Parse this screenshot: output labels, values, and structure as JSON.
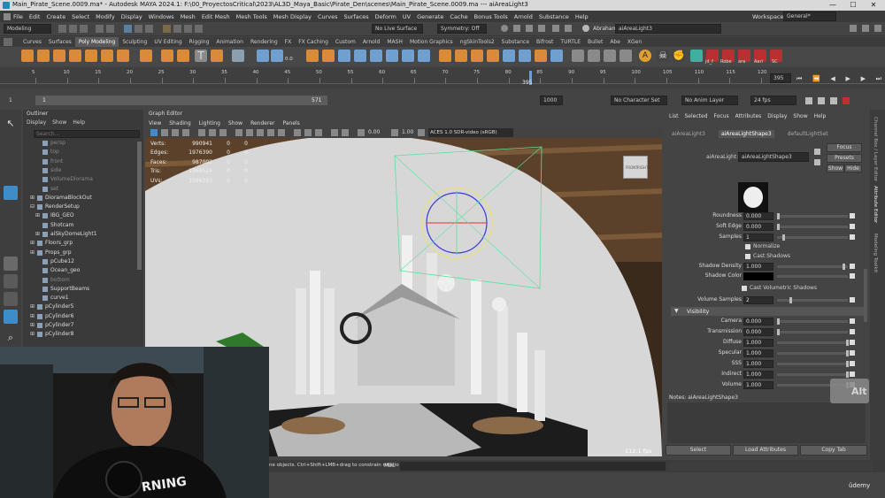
{
  "window": {
    "title": "Main_Pirate_Scene.0009.ma* - Autodesk MAYA 2024.1: F:\\00_ProyectosCritical\\2023\\AL3D_Maya_Basic\\Pirate_Den\\scenes\\Main_Pirate_Scene.0009.ma  ---  aiAreaLight3",
    "minimize": "—",
    "maximize": "☐",
    "close": "✕"
  },
  "menubar": {
    "items": [
      "File",
      "Edit",
      "Create",
      "Select",
      "Modify",
      "Display",
      "Windows",
      "Mesh",
      "Edit Mesh",
      "Mesh Tools",
      "Mesh Display",
      "Curves",
      "Surfaces",
      "Deform",
      "UV",
      "Generate",
      "Cache",
      "Bonus Tools",
      "Arnold",
      "Substance",
      "Help"
    ],
    "workspace_label": "Workspace:",
    "workspace_value": "General*"
  },
  "statusline": {
    "mode": "Modeling",
    "live_surface": "No Live Surface",
    "symmetry": "Symmetry: Off",
    "user": "Abraham Leal",
    "search_value": "aiAreaLight3"
  },
  "shelf": {
    "tabs": [
      "Curves",
      "Surfaces",
      "Poly Modeling",
      "Sculpting",
      "UV Editing",
      "Rigging",
      "Animation",
      "Rendering",
      "FX",
      "FX Caching",
      "Custom",
      "Arnold",
      "MASH",
      "Motion Graphics",
      "ngSkinTools2",
      "Substance",
      "Bifrost",
      "TURTLE",
      "Bullet",
      "Abe",
      "XGen"
    ],
    "active_tab": "Poly Modeling",
    "counters": [
      "0.0",
      "0.0"
    ],
    "right_labels": [
      "jd_f",
      "Robe",
      "ara",
      "Aari",
      "SC"
    ]
  },
  "timeline": {
    "ticks": [
      "5",
      "10",
      "15",
      "20",
      "25",
      "30",
      "35",
      "40",
      "45",
      "50",
      "55",
      "60",
      "65",
      "70",
      "75",
      "80",
      "85",
      "90",
      "95",
      "100",
      "105",
      "110",
      "115",
      "120"
    ],
    "current_frame": "395"
  },
  "range": {
    "start": "1",
    "start2": "1",
    "end_inner": "571",
    "end": "1000",
    "character_set": "No Character Set",
    "anim_layer": "No Anim Layer",
    "fps": "24 fps"
  },
  "outliner": {
    "title": "Outliner",
    "menu": [
      "Display",
      "Show",
      "Help"
    ],
    "search_placeholder": "Search...",
    "items": [
      {
        "label": "persp",
        "depth": 1,
        "exp": ""
      },
      {
        "label": "top",
        "depth": 1,
        "exp": ""
      },
      {
        "label": "front",
        "depth": 1,
        "exp": ""
      },
      {
        "label": "side",
        "depth": 1,
        "exp": ""
      },
      {
        "label": "VolumeDiorama",
        "depth": 1,
        "exp": ""
      },
      {
        "label": "set",
        "depth": 1,
        "exp": ""
      },
      {
        "label": "DioramaBlockOut",
        "depth": 0,
        "exp": "+"
      },
      {
        "label": "RenderSetup",
        "depth": 0,
        "exp": "-"
      },
      {
        "label": "IBG_GEO",
        "depth": 1,
        "exp": "+"
      },
      {
        "label": "Shotcam",
        "depth": 1,
        "exp": ""
      },
      {
        "label": "aiSkyDomeLight1",
        "depth": 1,
        "exp": "+"
      },
      {
        "label": "Floors_grp",
        "depth": 0,
        "exp": "+"
      },
      {
        "label": "Props_grp",
        "depth": 0,
        "exp": "+"
      },
      {
        "label": "pCube12",
        "depth": 1,
        "exp": ""
      },
      {
        "label": "Ocean_geo",
        "depth": 1,
        "exp": ""
      },
      {
        "label": "bottom",
        "depth": 1,
        "exp": ""
      },
      {
        "label": "SupportBeams",
        "depth": 1,
        "exp": ""
      },
      {
        "label": "curve1",
        "depth": 1,
        "exp": ""
      },
      {
        "label": "pCylinder5",
        "depth": 0,
        "exp": "+"
      },
      {
        "label": "pCylinder6",
        "depth": 0,
        "exp": "+"
      },
      {
        "label": "pCylinder7",
        "depth": 0,
        "exp": "+"
      },
      {
        "label": "pCylinder8",
        "depth": 0,
        "exp": "+"
      }
    ]
  },
  "viewport": {
    "panel_title": "Graph Editor",
    "menu": [
      "View",
      "Shading",
      "Lighting",
      "Show",
      "Renderer",
      "Panels"
    ],
    "exposure": "0.00",
    "gamma": "1.00",
    "color_space": "ACES 1.0 SDR-video (sRGB)",
    "hud": [
      {
        "label": "Verts:",
        "a": "990941",
        "b": "0",
        "c": "0"
      },
      {
        "label": "Edges:",
        "a": "1976390",
        "b": "0",
        "c": "0"
      },
      {
        "label": "Faces:",
        "a": "987002",
        "b": "0",
        "c": "0"
      },
      {
        "label": "Tris:",
        "a": "1969524",
        "b": "0",
        "c": "0"
      },
      {
        "label": "UVs:",
        "a": "1096253",
        "b": "0",
        "c": "0"
      }
    ],
    "fps": "112.1 fps",
    "cube_front": "FRONT",
    "cube_right": "RIGHT"
  },
  "attr_editor": {
    "menu": [
      "List",
      "Selected",
      "Focus",
      "Attributes",
      "Display",
      "Show",
      "Help"
    ],
    "tabs": [
      "aiAreaLight3",
      "aiAreaLightShape3",
      "defaultLightSet"
    ],
    "active_tab": "aiAreaLightShape3",
    "node_label": "aiAreaLight:",
    "node_value": "aiAreaLightShape3",
    "focus": "Focus",
    "presets": "Presets",
    "show": "Show",
    "hide": "Hide",
    "attrs": [
      {
        "label": "Roundness",
        "value": "0.000",
        "knob": 0
      },
      {
        "label": "Soft Edge",
        "value": "0.000",
        "knob": 0
      },
      {
        "label": "Samples",
        "value": "1",
        "knob": 6
      }
    ],
    "normalize": "Normalize",
    "cast_shadows": "Cast Shadows",
    "shadow_density_label": "Shadow Density",
    "shadow_density": "1.000",
    "shadow_color_label": "Shadow Color",
    "cast_vol_shadows": "Cast Volumetric Shadows",
    "volume_samples_label": "Volume Samples",
    "volume_samples": "2",
    "visibility_header": "Visibility",
    "visibility": [
      {
        "label": "Camera",
        "value": "0.000",
        "knob": 0
      },
      {
        "label": "Transmission",
        "value": "0.000",
        "knob": 0
      },
      {
        "label": "Diffuse",
        "value": "1.000",
        "knob": 78
      },
      {
        "label": "Specular",
        "value": "1.000",
        "knob": 78
      },
      {
        "label": "SSS",
        "value": "1.000",
        "knob": 78
      },
      {
        "label": "Indirect",
        "value": "1.000",
        "knob": 78
      },
      {
        "label": "Volume",
        "value": "1.000",
        "knob": 78
      }
    ],
    "notes": "Notes:  aiAreaLightShape3",
    "select_btn": "Select",
    "load_btn": "Load Attributes",
    "copy_btn": "Copy Tab"
  },
  "side_tabs": [
    "Channel Box / Layer Editor",
    "Attribute Editor",
    "Modeling Toolkit"
  ],
  "cmd": {
    "help_text": "ne objects. Ctrl+Shift+LMB+drag to constrain rotatio",
    "mel": "MEL"
  },
  "overlay": {
    "alt": "Alt",
    "brand": "ûdemy",
    "shirt_text": "RNING"
  },
  "colors": {
    "accent_blue": "#5285a6",
    "viewport_bg": "#d8d8d8",
    "selection_green": "#5ee0a0",
    "light_yellow": "#e6e08a"
  }
}
